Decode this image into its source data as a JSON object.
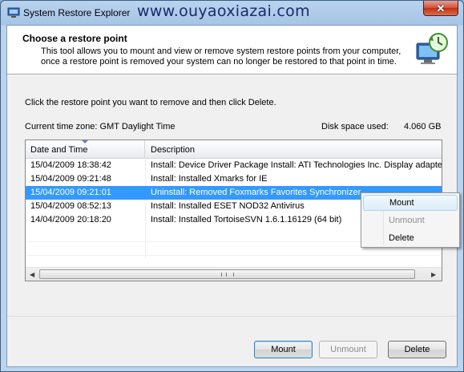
{
  "window": {
    "title": "System Restore Explorer",
    "watermark": "www.ouyaoxiazai.com",
    "close_label": "✕"
  },
  "header": {
    "title": "Choose a restore point",
    "description": "This tool allows you to mount and view or remove system restore points from your computer, once a restore point is removed your system can no longer be restored to that point in time."
  },
  "main": {
    "instruction": "Click the restore point you want to remove and then click Delete.",
    "timezone_label": "Current time zone:",
    "timezone_value": "GMT Daylight Time",
    "disk_label": "Disk space used:",
    "disk_value": "4.060 GB"
  },
  "table": {
    "columns": [
      "Date and Time",
      "Description"
    ],
    "rows": [
      {
        "date": "15/04/2009 18:38:42",
        "desc": "Install: Device Driver Package Install: ATI Technologies Inc. Display adapter"
      },
      {
        "date": "15/04/2009 09:21:48",
        "desc": "Install: Installed Xmarks for IE"
      },
      {
        "date": "15/04/2009 09:21:01",
        "desc": "Uninstall: Removed Foxmarks Favorites Synchronizer"
      },
      {
        "date": "15/04/2009 08:52:13",
        "desc": "Install: Installed ESET NOD32 Antivirus"
      },
      {
        "date": "14/04/2009 20:18:20",
        "desc": "Install: Installed TortoiseSVN 1.6.1.16129 (64 bit)"
      }
    ],
    "selected_index": 2
  },
  "context_menu": {
    "items": [
      "Mount",
      "Unmount",
      "Delete"
    ]
  },
  "buttons": {
    "mount": "Mount",
    "unmount": "Unmount",
    "delete": "Delete"
  },
  "colors": {
    "selection": "#3399ff",
    "title_gradient_top": "#b9d3ee"
  }
}
